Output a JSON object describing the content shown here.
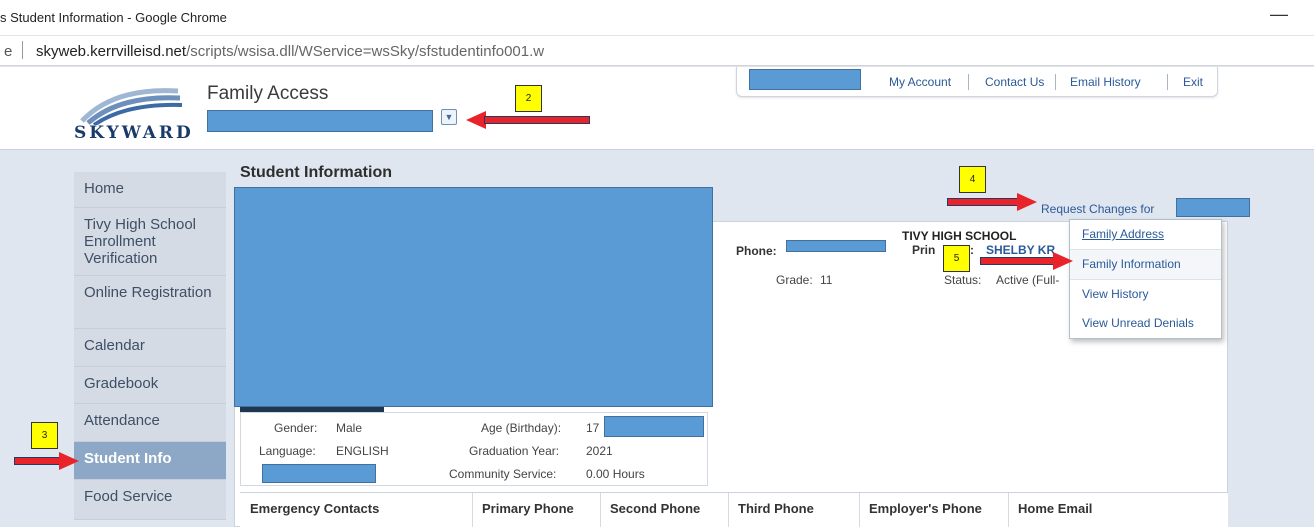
{
  "browser": {
    "window_title": "s Student Information - Google Chrome",
    "url_prefix": "e",
    "url_host": "skyweb.kerrvilleisd.net",
    "url_path": "/scripts/wsisa.dll/WService=wsSky/sfstudentinfo001.w",
    "minimize_glyph": "—"
  },
  "header": {
    "logo_text": "SKYWARD",
    "app_title": "Family Access",
    "top_links": [
      "My Account",
      "Contact Us",
      "Email History",
      "Exit"
    ]
  },
  "sidebar": {
    "items": [
      {
        "label": "Home",
        "active": false
      },
      {
        "label": "Tivy High School Enrollment Verification",
        "active": false
      },
      {
        "label": "Online Registration",
        "active": false
      },
      {
        "label": "Calendar",
        "active": false
      },
      {
        "label": "Gradebook",
        "active": false
      },
      {
        "label": "Attendance",
        "active": false
      },
      {
        "label": "Student Info",
        "active": true
      },
      {
        "label": "Food Service",
        "active": false
      }
    ]
  },
  "main": {
    "title": "Student Information",
    "request_changes": "Request Changes for",
    "school_name": "TIVY HIGH SCHOOL",
    "phone_label": "Phone:",
    "principal_label_prefix": "Prin",
    "principal_label_suffix": ":",
    "principal_name": "SHELBY KR",
    "grade_label": "Grade:",
    "grade_value": "11",
    "status_label": "Status:",
    "status_value": "Active (Full-",
    "gender_label": "Gender:",
    "gender_value": "Male",
    "language_label": "Language:",
    "language_value": "ENGLISH",
    "age_label": "Age (Birthday):",
    "age_value": "17",
    "grad_year_label": "Graduation Year:",
    "grad_year_value": "2021",
    "community_label": "Community Service:",
    "community_value": "0.00 Hours"
  },
  "request_menu": {
    "items": [
      "Family Address",
      "Family Information",
      "View History",
      "View Unread Denials"
    ]
  },
  "table": {
    "headers": [
      "Emergency Contacts",
      "Primary Phone",
      "Second Phone",
      "Third Phone",
      "Employer's Phone",
      "Home Email"
    ]
  },
  "annotations": {
    "callouts": [
      "2",
      "3",
      "4",
      "5"
    ],
    "highlight_color": "#ffff00",
    "arrow_color": "#e8242a",
    "redaction_color": "#5b9bd5"
  }
}
